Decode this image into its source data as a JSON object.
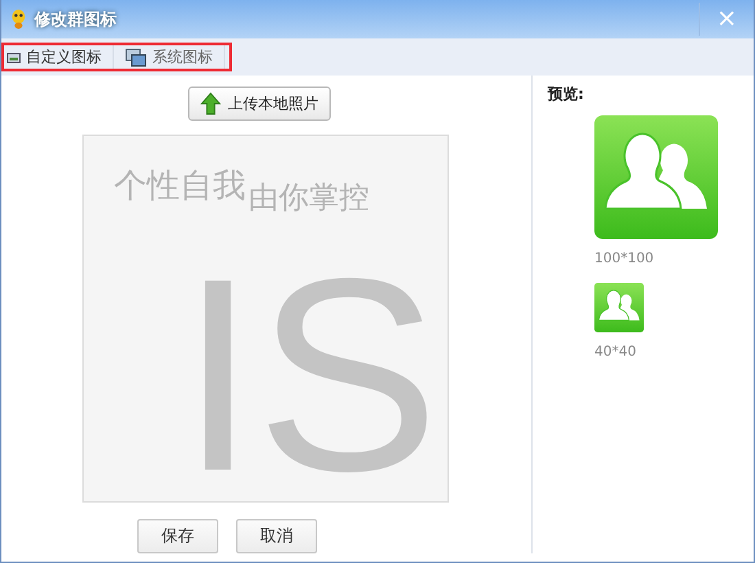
{
  "window": {
    "title": "修改群图标",
    "close": "×"
  },
  "tabs": [
    {
      "label": "自定义图标",
      "selected": true,
      "kind": "picture"
    },
    {
      "label": "系统图标",
      "selected": false,
      "kind": "stack"
    }
  ],
  "upload_button": "上传本地照片",
  "crop_area": {
    "slogan_left": "个性自我",
    "slogan_right": "由你掌控",
    "letters": "IS"
  },
  "preview": {
    "label": "预览:",
    "items": [
      {
        "kind": "large",
        "caption": "100*100"
      },
      {
        "kind": "small",
        "caption": "40*40"
      }
    ]
  },
  "buttons": [
    "保存",
    "取消"
  ]
}
